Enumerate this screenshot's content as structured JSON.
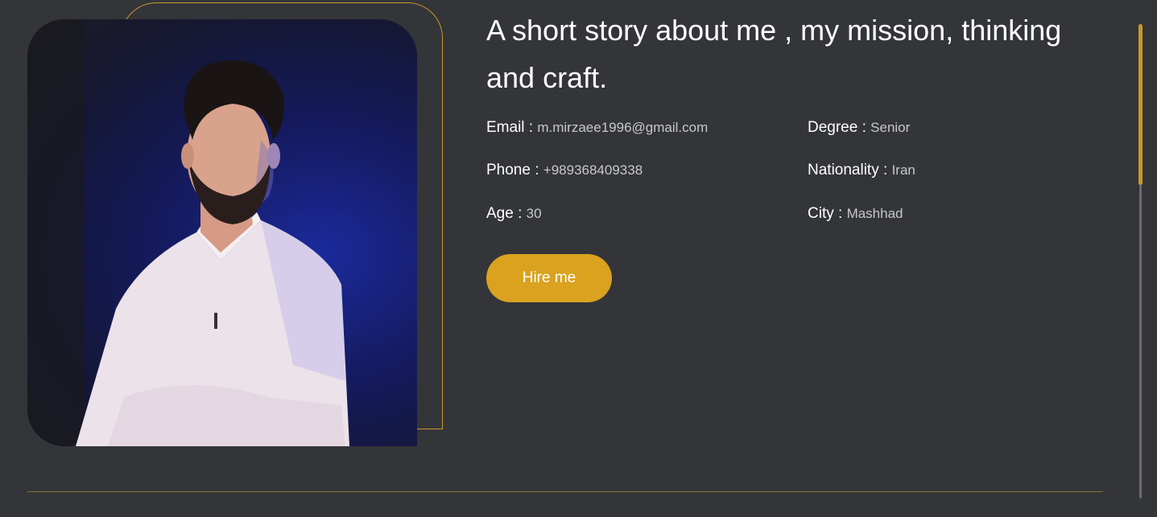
{
  "about": {
    "heading": "A short story about me , my mission, thinking and craft.",
    "photo_alt": "portrait",
    "info": [
      {
        "label": "Email :",
        "value": "m.mirzaee1996@gmail.com"
      },
      {
        "label": "Degree :",
        "value": "Senior"
      },
      {
        "label": "Phone :",
        "value": "+989368409338"
      },
      {
        "label": "Nationality :",
        "value": "Iran"
      },
      {
        "label": "Age :",
        "value": "30"
      },
      {
        "label": "City :",
        "value": "Mashhad"
      }
    ],
    "hire_label": "Hire me"
  },
  "colors": {
    "background": "#343539",
    "accent": "#daa21f",
    "outline": "#c59a2a"
  }
}
